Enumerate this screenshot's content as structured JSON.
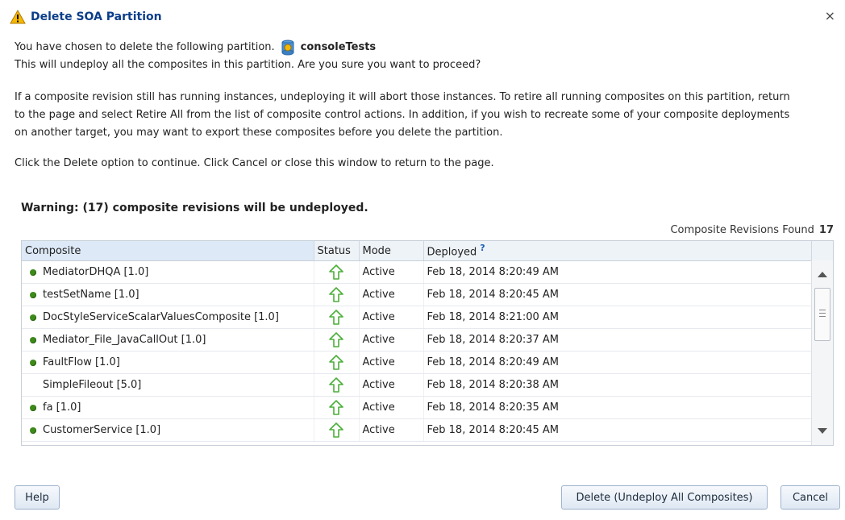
{
  "dialog": {
    "title": "Delete SOA Partition",
    "close_label": "×"
  },
  "message": {
    "line1_prefix": "You have chosen to delete the following partition.",
    "partition_name": "consoleTests",
    "line2": "This will undeploy all the composites in this partition. Are you sure you want to proceed?",
    "line3a": "If a composite revision still has running instances, undeploying it will abort those instances. To retire all running composites on this partition, return",
    "line3b": "to the page and select Retire All from the list of composite control actions. In addition, if you wish to recreate some of your composite deployments",
    "line3c": "on another target, you may want to export these composites before you delete the partition.",
    "line4": "Click the Delete option to continue. Click Cancel or close this window to return to the page."
  },
  "warning": "Warning: (17) composite revisions will be undeployed.",
  "found": {
    "label": "Composite Revisions Found",
    "count": "17"
  },
  "table": {
    "headers": {
      "composite": "Composite",
      "status": "Status",
      "mode": "Mode",
      "deployed": "Deployed",
      "deployed_help": "?"
    },
    "rows": [
      {
        "composite": "MediatorDHQA [1.0]",
        "mode": "Active",
        "deployed": "Feb 18, 2014 8:20:49 AM",
        "dot": true
      },
      {
        "composite": "testSetName [1.0]",
        "mode": "Active",
        "deployed": "Feb 18, 2014 8:20:45 AM",
        "dot": true
      },
      {
        "composite": "DocStyleServiceScalarValuesComposite [1.0]",
        "mode": "Active",
        "deployed": "Feb 18, 2014 8:21:00 AM",
        "dot": true
      },
      {
        "composite": "Mediator_File_JavaCallOut [1.0]",
        "mode": "Active",
        "deployed": "Feb 18, 2014 8:20:37 AM",
        "dot": true
      },
      {
        "composite": "FaultFlow [1.0]",
        "mode": "Active",
        "deployed": "Feb 18, 2014 8:20:49 AM",
        "dot": true
      },
      {
        "composite": "SimpleFileout [5.0]",
        "mode": "Active",
        "deployed": "Feb 18, 2014 8:20:38 AM",
        "dot": false
      },
      {
        "composite": "fa [1.0]",
        "mode": "Active",
        "deployed": "Feb 18, 2014 8:20:35 AM",
        "dot": true
      },
      {
        "composite": "CustomerService [1.0]",
        "mode": "Active",
        "deployed": "Feb 18, 2014 8:20:45 AM",
        "dot": true
      }
    ]
  },
  "buttons": {
    "help": "Help",
    "delete": "Delete (Undeploy All Composites)",
    "cancel": "Cancel"
  },
  "colors": {
    "title": "#0b3e8a",
    "status_dot": "#3d8a1a",
    "status_arrow": "#4caf3a"
  },
  "icons": {
    "title": "warning-icon",
    "partition": "partition-icon",
    "status": "up-arrow-icon"
  }
}
